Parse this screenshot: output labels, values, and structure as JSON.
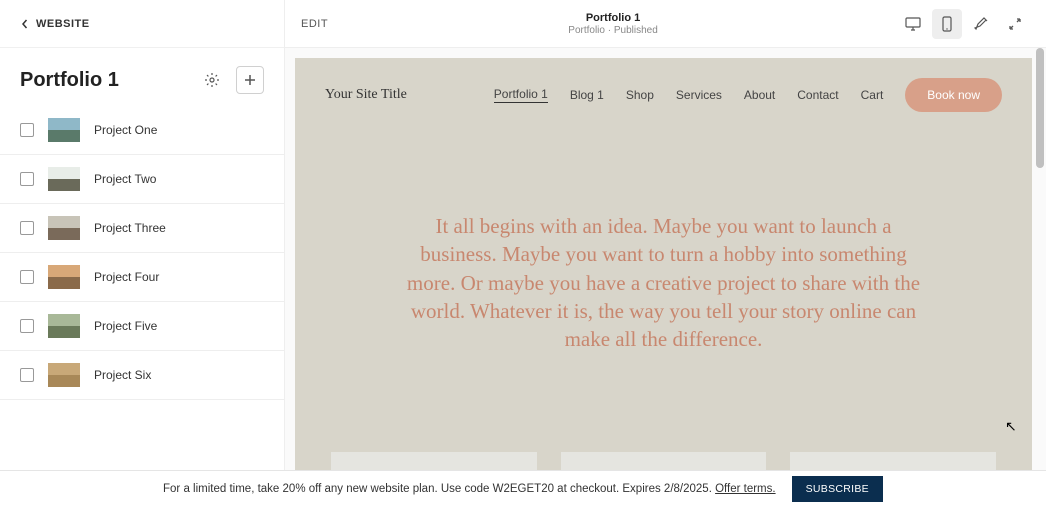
{
  "sidebar": {
    "back_label": "WEBSITE",
    "title": "Portfolio 1",
    "projects": [
      {
        "name": "Project One",
        "thumb_colors": [
          "#8fb8c8",
          "#5a7a6a"
        ]
      },
      {
        "name": "Project Two",
        "thumb_colors": [
          "#e8ede8",
          "#6a6a5a"
        ]
      },
      {
        "name": "Project Three",
        "thumb_colors": [
          "#c8c4b8",
          "#7a6a5a"
        ]
      },
      {
        "name": "Project Four",
        "thumb_colors": [
          "#d8a878",
          "#8a6a4a"
        ]
      },
      {
        "name": "Project Five",
        "thumb_colors": [
          "#a8b898",
          "#6a7a5a"
        ]
      },
      {
        "name": "Project Six",
        "thumb_colors": [
          "#c8a878",
          "#a88858"
        ]
      }
    ]
  },
  "preview": {
    "edit_label": "EDIT",
    "title": "Portfolio 1",
    "subtitle": "Portfolio · Published"
  },
  "site": {
    "title": "Your Site Title",
    "nav": [
      "Portfolio 1",
      "Blog 1",
      "Shop",
      "Services",
      "About",
      "Contact",
      "Cart"
    ],
    "active_nav": 0,
    "cta": "Book now",
    "hero": "It all begins with an idea. Maybe you want to launch a business. Maybe you want to turn a hobby into something more. Or maybe you have a creative project to share with the world. Whatever it is, the way you tell your story online can make all the difference."
  },
  "promo": {
    "text": "For a limited time, take 20% off any new website plan. Use code W2EGET20 at checkout. Expires 2/8/2025.",
    "terms": "Offer terms.",
    "cta": "SUBSCRIBE"
  }
}
